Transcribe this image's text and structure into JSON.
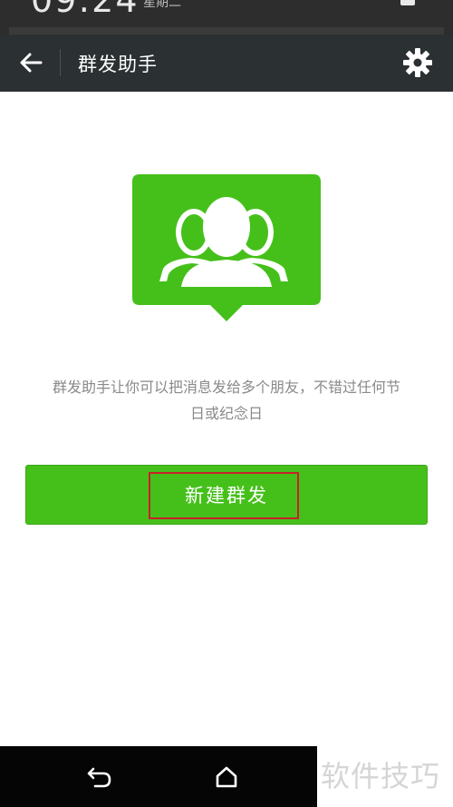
{
  "status_bar": {
    "time": "09:24",
    "date": "星期二"
  },
  "header": {
    "title": "群发助手",
    "back_icon": "arrow-left-icon",
    "settings_icon": "gear-icon"
  },
  "main": {
    "illustration_icon": "group-chat-bubble-icon",
    "description_line1": "群发助手让你可以把消息发给多个朋友，不错过任何节",
    "description_line2": "日或纪念日",
    "new_button_label": "新建群发"
  },
  "nav": {
    "back_icon": "back-icon",
    "home_icon": "home-icon"
  },
  "watermark": "软件技巧",
  "colors": {
    "accent_green": "#45c01a",
    "app_bar": "#2b3133",
    "highlight_red": "#c8202a"
  }
}
